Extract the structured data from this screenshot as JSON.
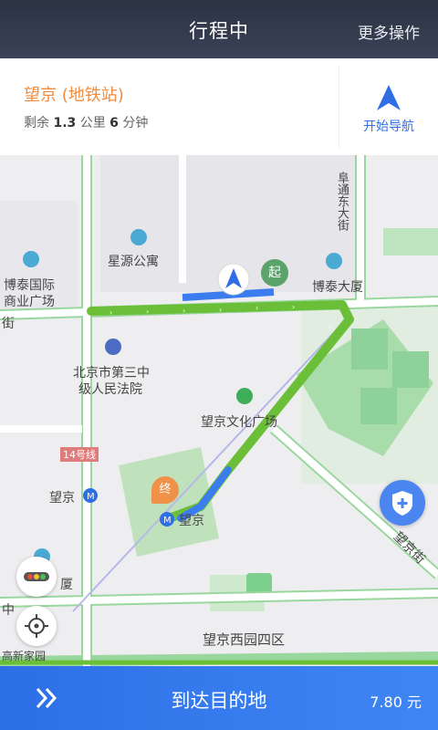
{
  "header": {
    "title": "行程中",
    "more_label": "更多操作"
  },
  "trip": {
    "destination": "望京 (地铁站)",
    "remain_prefix": "剩余",
    "distance": "1.3",
    "distance_unit": "公里",
    "time": "6",
    "time_unit": "分钟",
    "nav_label": "开始导航"
  },
  "map": {
    "pois": {
      "xingyuan": "星源公寓",
      "botai_intl_1": "博泰国际",
      "botai_intl_2": "商业广场",
      "botai_tower": "博泰大厦",
      "court_1": "北京市第三中",
      "court_2": "级人民法院",
      "culture_square": "望京文化广场",
      "wangjing_station": "望京",
      "wangjing_station_right": "望京",
      "tower_left": "厦",
      "district": "望京西园四区",
      "road_right": "望京街",
      "road_top": "阜通东大街",
      "line14": "14号线",
      "start_marker": "起",
      "dest_marker": "终",
      "left_edge": "街",
      "left_edge2": "中",
      "bottom_left": "高新家园"
    },
    "colors": {
      "route": "#67b832",
      "route_blue": "#3b7df0"
    }
  },
  "bottom": {
    "arrive_label": "到达目的地",
    "price": "7.80 元"
  }
}
